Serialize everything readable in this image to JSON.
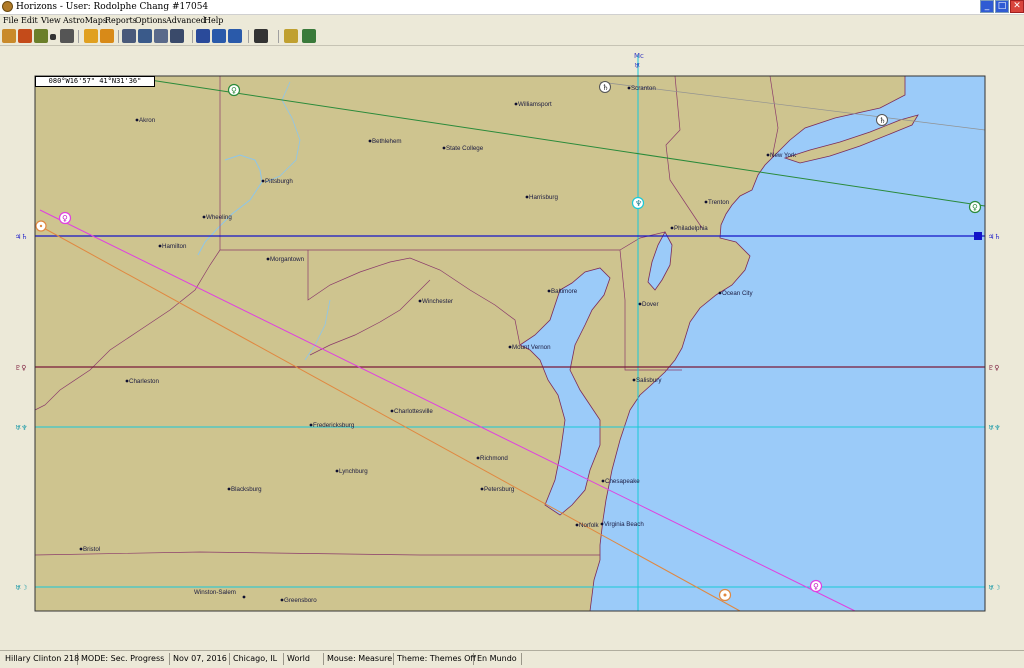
{
  "window": {
    "title": "Horizons - User: Rodolphe Chang #17054",
    "min": "_",
    "max": "□",
    "close": "✕"
  },
  "menu": [
    "File",
    "Edit",
    "View",
    "AstroMaps",
    "Reports",
    "Options",
    "Advanced",
    "Help"
  ],
  "toolbar": [
    {
      "name": "edit-icon",
      "color": "#c98a2b"
    },
    {
      "name": "chart-list-icon",
      "color": "#c44b1a"
    },
    {
      "name": "notes-icon",
      "color": "#6b7f2a"
    },
    {
      "name": "dropdown-arrow-icon",
      "color": "#333333"
    },
    {
      "name": "print-icon",
      "color": "#555555"
    },
    {
      "name": "astro-wheel-icon",
      "color": "#e0a020"
    },
    {
      "name": "astro-wheel-alt-icon",
      "color": "#d88a18"
    },
    {
      "name": "tools-icon",
      "color": "#4a5a7a"
    },
    {
      "name": "settings-icon",
      "color": "#3a5a8a"
    },
    {
      "name": "relocate-icon",
      "color": "#5a6a8a"
    },
    {
      "name": "table-icon",
      "color": "#3a4a6a"
    },
    {
      "name": "map-view-icon",
      "color": "#2a4a9a"
    },
    {
      "name": "zoom-in-icon",
      "color": "#2a5aaa"
    },
    {
      "name": "zoom-out-icon",
      "color": "#2a5aaa"
    },
    {
      "name": "grid-icon",
      "color": "#333333"
    },
    {
      "name": "sun-icon",
      "color": "#c0a030"
    },
    {
      "name": "globe-icon",
      "color": "#3a7a3a"
    }
  ],
  "map": {
    "coordinate_readout": "080°W16'57\"   41°N31'36\"",
    "mc_label": "Mc",
    "mc_symbol": "♅",
    "colors": {
      "land": "#cec48f",
      "water": "#9bcbf9",
      "border": "#7a2a5a"
    },
    "cities": [
      {
        "name": "Scranton"
      },
      {
        "name": "Akron"
      },
      {
        "name": "Williamsport"
      },
      {
        "name": "Bethlehem"
      },
      {
        "name": "State College"
      },
      {
        "name": "New York"
      },
      {
        "name": "Pittsburgh"
      },
      {
        "name": "Harrisburg"
      },
      {
        "name": "Trenton"
      },
      {
        "name": "Wheeling"
      },
      {
        "name": "Philadelphia"
      },
      {
        "name": "Hamilton"
      },
      {
        "name": "Morgantown"
      },
      {
        "name": "Baltimore"
      },
      {
        "name": "Ocean City"
      },
      {
        "name": "Winchester"
      },
      {
        "name": "Dover"
      },
      {
        "name": "Mount Vernon"
      },
      {
        "name": "Charleston"
      },
      {
        "name": "Salisbury"
      },
      {
        "name": "Charlottesville"
      },
      {
        "name": "Fredericksburg"
      },
      {
        "name": "Richmond"
      },
      {
        "name": "Lynchburg"
      },
      {
        "name": "Petersburg"
      },
      {
        "name": "Chesapeake"
      },
      {
        "name": "Blacksburg"
      },
      {
        "name": "Norfolk"
      },
      {
        "name": "Virginia Beach"
      },
      {
        "name": "Bristol"
      },
      {
        "name": "Winston-Salem"
      },
      {
        "name": "Greensboro"
      }
    ],
    "horizontal_lines": [
      {
        "left_label": "♃♄",
        "right_label": "♃♄",
        "color": "#1414c8"
      },
      {
        "left_label": "♇♀",
        "right_label": "♇♀",
        "color": "#7a1a3a"
      },
      {
        "left_label": "♅♆",
        "right_label": "♅♆",
        "color": "#18c8d8"
      },
      {
        "left_label": "♅☽",
        "right_label": "♅☽",
        "color": "#18c8d8"
      }
    ],
    "diagonal_lines": [
      {
        "planet": "Venus",
        "color": "#e040e0"
      },
      {
        "planet": "Sun",
        "color": "#e08840"
      },
      {
        "planet": "Venus",
        "color": "#2a8a3a"
      },
      {
        "planet": "Saturn",
        "color": "#909090"
      }
    ]
  },
  "status": [
    "Hillary Clinton 218",
    "MODE: Sec. Progress",
    "Nov 07, 2016",
    "Chicago, IL",
    "World",
    "Mouse: Measure",
    "Theme: Themes Off",
    "En Mundo"
  ]
}
